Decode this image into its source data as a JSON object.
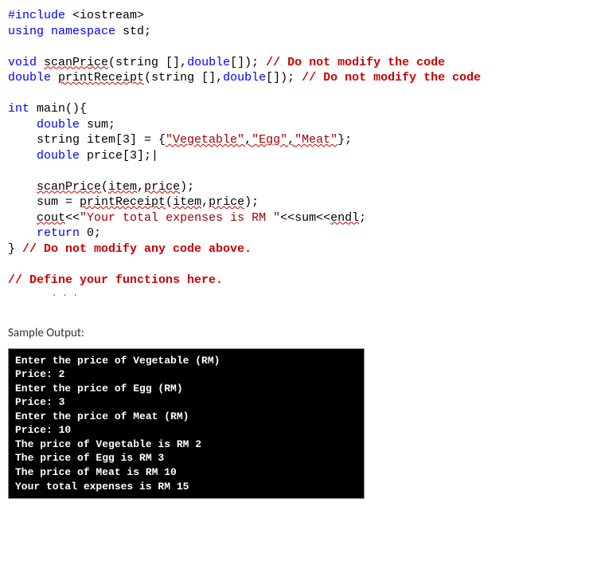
{
  "code": {
    "l1_a": "#include",
    "l1_b": " <iostream>",
    "l2_a": "using",
    "l2_b": " namespace",
    "l2_c": " std;",
    "l3_a": "void",
    "l3_b": " ",
    "l3_fn": "scanPrice",
    "l3_c": "(string [],",
    "l3_d": "double",
    "l3_e": "[]); ",
    "l3_cmt": "// Do not modify the code",
    "l4_a": "double",
    "l4_b": " ",
    "l4_fn": "printReceipt",
    "l4_c": "(string [],",
    "l4_d": "double",
    "l4_e": "[]); ",
    "l4_cmt": "// Do not modify the code",
    "l5_a": "int",
    "l5_b": " main(){",
    "l6_a": "    ",
    "l6_b": "double",
    "l6_c": " sum;",
    "l7_a": "    string item[3] = {",
    "l7_s1": "\"Vegetable\"",
    "l7_c1": ",",
    "l7_s2": "\"Egg\"",
    "l7_c2": ",",
    "l7_s3": "\"Meat\"",
    "l7_e": "};",
    "l8_a": "    ",
    "l8_b": "double",
    "l8_c": " price[3];|",
    "l9_a": "    ",
    "l9_fn": "scanPrice",
    "l9_b": "(",
    "l9_p1": "item",
    "l9_c": ",",
    "l9_p2": "price",
    "l9_d": ");",
    "l10_a": "    sum = ",
    "l10_fn": "printReceipt",
    "l10_b": "(",
    "l10_p1": "item",
    "l10_c": ",",
    "l10_p2": "price",
    "l10_d": ");",
    "l11_a": "    ",
    "l11_cout": "cout",
    "l11_b": "<<",
    "l11_s": "\"Your total expenses is RM \"",
    "l11_c": "<<sum<<",
    "l11_endl": "endl",
    "l11_d": ";",
    "l12_a": "    ",
    "l12_b": "return",
    "l12_c": " 0;",
    "l13_a": "} ",
    "l13_cmt": "// Do not modify any code above.",
    "l14_cmt": "// Define your functions here."
  },
  "sample_header": "Sample Output:",
  "terminal": {
    "l1": "Enter the price of Vegetable (RM)",
    "l2": "Price: 2",
    "l3": "Enter the price of Egg (RM)",
    "l4": "Price: 3",
    "l5": "Enter the price of Meat (RM)",
    "l6": "Price: 10",
    "l7": "The price of Vegetable is RM 2",
    "l8": "The price of Egg is RM 3",
    "l9": "The price of Meat is RM 10",
    "l10": "Your total expenses is RM 15"
  }
}
